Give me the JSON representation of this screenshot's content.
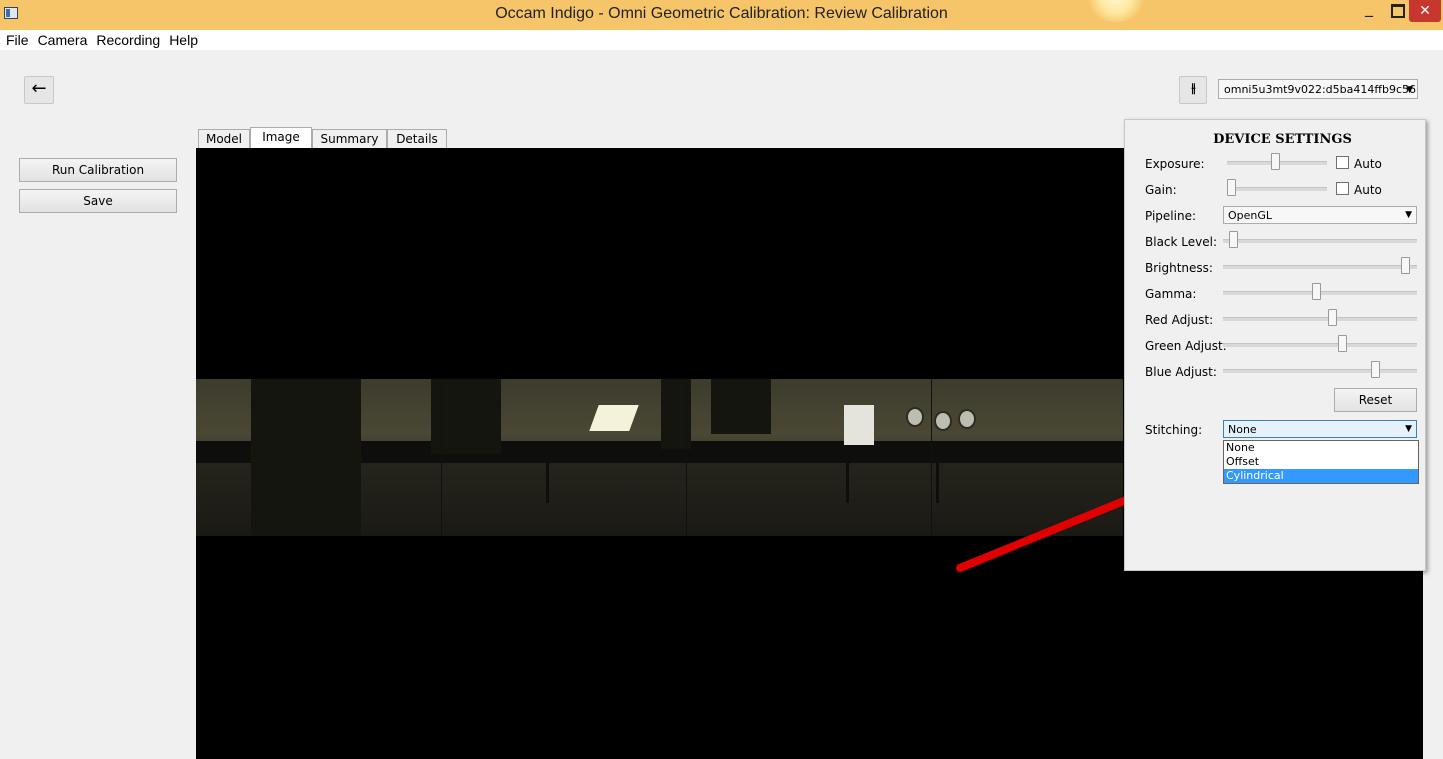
{
  "window": {
    "title": "Occam Indigo - Omni Geometric Calibration: Review Calibration",
    "minimize_label": "_",
    "close_label": "✕"
  },
  "menu": [
    "File",
    "Camera",
    "Recording",
    "Help"
  ],
  "toolbar": {
    "back_icon": "←",
    "settings_icon": "⫲",
    "device_value": "omni5u3mt9v022:d5ba414ffb9c56\u0000",
    "device_display": "omni5u3mt9v022:d5ba414ffb9c56‹"
  },
  "actions": {
    "run_calibration": "Run Calibration",
    "save": "Save"
  },
  "tabs": [
    "Model",
    "Image",
    "Summary",
    "Details"
  ],
  "active_tab": "Image",
  "device_settings": {
    "title": "DEVICE SETTINGS",
    "exposure_label": "Exposure:",
    "exposure_level": 0.48,
    "exposure_auto_label": "Auto",
    "exposure_auto": false,
    "gain_label": "Gain:",
    "gain_level": 0.0,
    "gain_auto_label": "Auto",
    "gain_auto": false,
    "pipeline_label": "Pipeline:",
    "pipeline_value": "OpenGL",
    "black_level_label": "Black Level:",
    "black_level": 0.03,
    "brightness_label": "Brightness:",
    "brightness": 0.96,
    "gamma_label": "Gamma:",
    "gamma": 0.48,
    "red_adjust_label": "Red Adjust:",
    "red_adjust": 0.57,
    "green_adjust_label": "Green Adjust:",
    "green_adjust": 0.62,
    "blue_adjust_label": "Blue Adjust:",
    "blue_adjust": 0.8,
    "reset_label": "Reset",
    "stitching_label": "Stitching:",
    "stitching_value": "None",
    "stitching_options": [
      "None",
      "Offset",
      "Cylindrical"
    ],
    "stitching_highlighted": "Cylindrical"
  },
  "colors": {
    "titlebar": "#f6c56a",
    "close_button": "#c7372e",
    "selection": "#3399ff",
    "annotation_arrow": "#e00000"
  }
}
